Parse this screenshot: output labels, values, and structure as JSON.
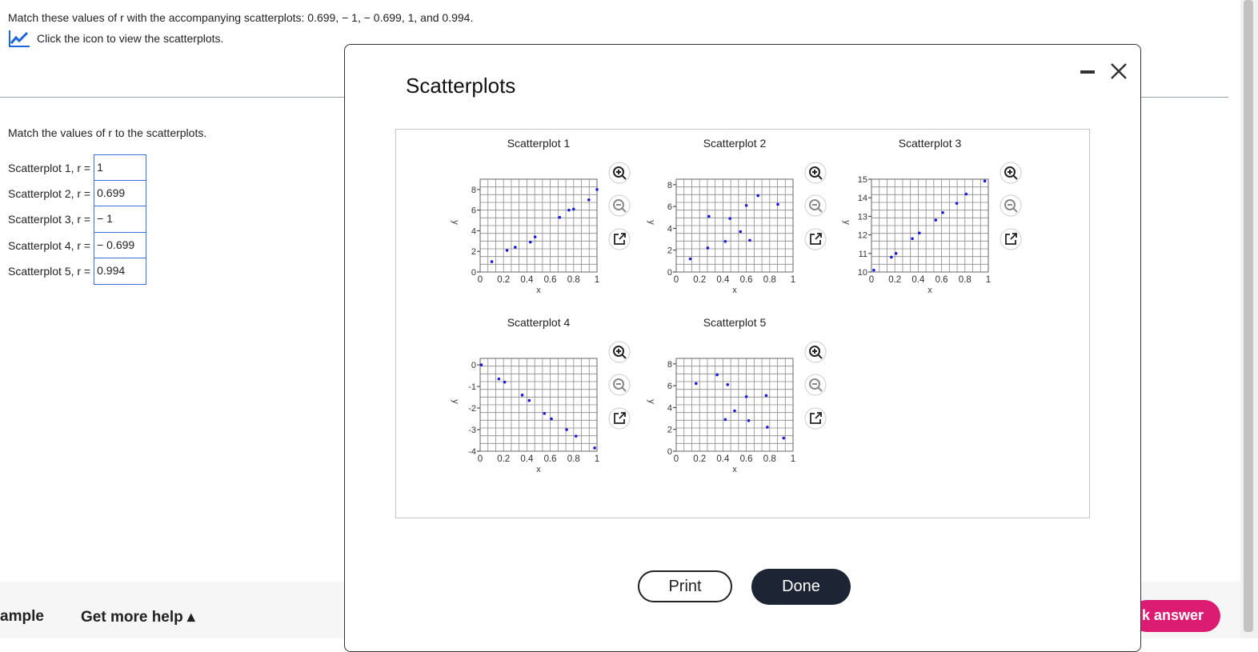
{
  "question": {
    "prompt": "Match these values of r with the accompanying scatterplots: 0.699, − 1, − 0.699, 1, and 0.994.",
    "hint": "Click the icon to view the scatterplots.",
    "match_label": "Match the values of r to the scatterplots.",
    "rows": [
      {
        "label": "Scatterplot 1, r =",
        "value": "1"
      },
      {
        "label": "Scatterplot 2, r =",
        "value": "0.699"
      },
      {
        "label": "Scatterplot 3, r =",
        "value": "− 1"
      },
      {
        "label": "Scatterplot 4, r =",
        "value": "− 0.699"
      },
      {
        "label": "Scatterplot 5, r =",
        "value": "0.994"
      }
    ]
  },
  "footer": {
    "example_label": "ample",
    "help_label": "Get more help ▴",
    "answer_label": "k answer"
  },
  "modal": {
    "title": "Scatterplots",
    "minimize_icon": "minimize-icon",
    "close_icon": "close-icon",
    "print_label": "Print",
    "done_label": "Done",
    "accent_color": "#1d2433"
  },
  "chart_data": [
    {
      "type": "scatter",
      "title": "Scatterplot 1",
      "xlabel": "x",
      "ylabel": "y",
      "xlim": [
        0,
        1
      ],
      "ylim": [
        0,
        9
      ],
      "xticks": [
        0,
        0.2,
        0.4,
        0.6,
        0.8,
        1
      ],
      "yticks": [
        0,
        2,
        4,
        6,
        8
      ],
      "x": [
        0.1,
        0.23,
        0.3,
        0.43,
        0.47,
        0.68,
        0.76,
        0.8,
        0.93,
        1.0
      ],
      "y": [
        1.0,
        2.1,
        2.4,
        2.9,
        3.4,
        5.3,
        6.0,
        6.1,
        7.0,
        8.0
      ],
      "point_color": "#1a1adc"
    },
    {
      "type": "scatter",
      "title": "Scatterplot 2",
      "xlabel": "x",
      "ylabel": "y",
      "xlim": [
        0,
        1
      ],
      "ylim": [
        0,
        8.5
      ],
      "xticks": [
        0,
        0.2,
        0.4,
        0.6,
        0.8,
        1
      ],
      "yticks": [
        0,
        2,
        4,
        6,
        8
      ],
      "x": [
        0.12,
        0.27,
        0.28,
        0.42,
        0.46,
        0.55,
        0.6,
        0.63,
        0.7,
        0.87
      ],
      "y": [
        1.2,
        2.2,
        5.1,
        2.8,
        4.9,
        3.7,
        6.1,
        2.9,
        7.0,
        6.2
      ],
      "point_color": "#1a1adc"
    },
    {
      "type": "scatter",
      "title": "Scatterplot 3",
      "xlabel": "x",
      "ylabel": "y",
      "xlim": [
        0,
        1
      ],
      "ylim": [
        10,
        15
      ],
      "xticks": [
        0,
        0.2,
        0.4,
        0.6,
        0.8,
        1
      ],
      "yticks": [
        10,
        11,
        12,
        13,
        14,
        15
      ],
      "x": [
        0.02,
        0.17,
        0.21,
        0.35,
        0.41,
        0.55,
        0.61,
        0.73,
        0.81,
        0.97
      ],
      "y": [
        10.1,
        10.8,
        11.0,
        11.8,
        12.1,
        12.8,
        13.2,
        13.7,
        14.2,
        14.9
      ],
      "point_color": "#1a1adc"
    },
    {
      "type": "scatter",
      "title": "Scatterplot 4",
      "xlabel": "x",
      "ylabel": "y",
      "xlim": [
        0,
        1
      ],
      "ylim": [
        -4,
        0.3
      ],
      "xticks": [
        0,
        0.2,
        0.4,
        0.6,
        0.8,
        1
      ],
      "yticks": [
        -4,
        -3,
        -2,
        -1,
        0
      ],
      "x": [
        0.01,
        0.16,
        0.21,
        0.36,
        0.42,
        0.55,
        0.61,
        0.74,
        0.82,
        0.98
      ],
      "y": [
        0.0,
        -0.65,
        -0.8,
        -1.4,
        -1.65,
        -2.25,
        -2.5,
        -3.0,
        -3.3,
        -3.85
      ],
      "point_color": "#1a1adc"
    },
    {
      "type": "scatter",
      "title": "Scatterplot 5",
      "xlabel": "x",
      "ylabel": "y",
      "xlim": [
        0,
        1
      ],
      "ylim": [
        0,
        8.5
      ],
      "xticks": [
        0,
        0.2,
        0.4,
        0.6,
        0.8,
        1
      ],
      "yticks": [
        0,
        2,
        4,
        6,
        8
      ],
      "x": [
        0.17,
        0.35,
        0.42,
        0.44,
        0.5,
        0.6,
        0.62,
        0.77,
        0.78,
        0.92
      ],
      "y": [
        6.2,
        7.0,
        2.9,
        6.1,
        3.7,
        5.0,
        2.8,
        5.1,
        2.2,
        1.2
      ],
      "point_color": "#1a1adc"
    }
  ]
}
